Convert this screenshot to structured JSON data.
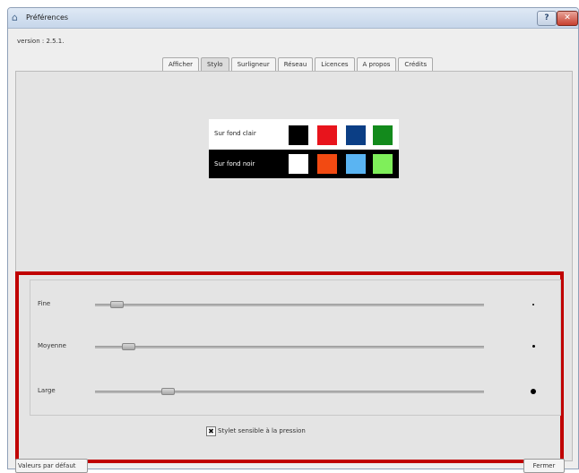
{
  "window": {
    "title": "Préférences",
    "help_label": "?",
    "close_label": "✕"
  },
  "version": "version : 2.5.1.",
  "tabs": [
    {
      "label": "Afficher"
    },
    {
      "label": "Stylo"
    },
    {
      "label": "Surligneur"
    },
    {
      "label": "Réseau"
    },
    {
      "label": "Licences"
    },
    {
      "label": "A propos"
    },
    {
      "label": "Crédits"
    }
  ],
  "active_tab": "Stylo",
  "colors": {
    "light": {
      "label": "Sur fond clair",
      "swatches": [
        "#000000",
        "#e8141c",
        "#0b3e85",
        "#138a1c"
      ]
    },
    "dark": {
      "label": "Sur fond noir",
      "swatches": [
        "#ffffff",
        "#f24a12",
        "#5ab4f2",
        "#7fef5a"
      ]
    }
  },
  "pressure": {
    "sliders": [
      {
        "label": "Fine",
        "level": 0.04
      },
      {
        "label": "Moyenne",
        "level": 0.07
      },
      {
        "label": "Large",
        "level": 0.17
      }
    ],
    "checkbox": {
      "checked_mark": "✖",
      "label": "Stylet sensible à la pression"
    },
    "highlight_color": "#c00000"
  },
  "buttons": {
    "reset_label": "Valeurs par défaut",
    "close_label": "Fermer"
  }
}
